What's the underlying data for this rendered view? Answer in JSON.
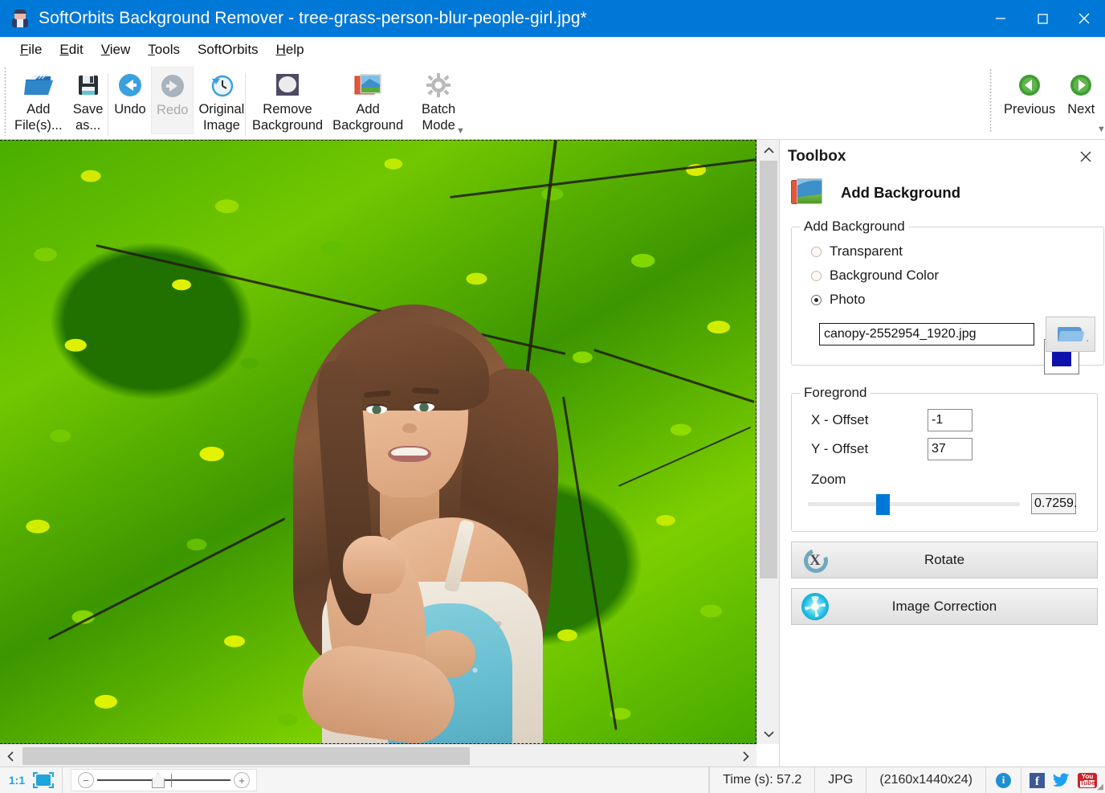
{
  "window": {
    "title": "SoftOrbits Background Remover - tree-grass-person-blur-people-girl.jpg*",
    "app_icon": "person-photo-icon",
    "minimize": "minimize-icon",
    "maximize": "maximize-icon",
    "close": "close-icon",
    "titlebar_color": "#0078d7"
  },
  "menu": {
    "items": [
      {
        "label": "File",
        "accel": "F"
      },
      {
        "label": "Edit",
        "accel": "E"
      },
      {
        "label": "View",
        "accel": "V"
      },
      {
        "label": "Tools",
        "accel": "T"
      },
      {
        "label": "SoftOrbits",
        "accel": ""
      },
      {
        "label": "Help",
        "accel": "H"
      }
    ]
  },
  "toolbar": {
    "buttons": [
      {
        "label": "Add\nFile(s)...",
        "icon": "open-folder-icon",
        "state": "normal"
      },
      {
        "label": "Save\nas...",
        "icon": "floppy-save-icon",
        "state": "normal"
      },
      {
        "label": "Undo",
        "icon": "undo-arrow-icon",
        "state": "normal"
      },
      {
        "label": "Redo",
        "icon": "redo-arrow-icon",
        "state": "disabled"
      },
      {
        "label": "Original\nImage",
        "icon": "clock-history-icon",
        "state": "normal"
      },
      {
        "label": "Remove\nBackground",
        "icon": "remove-background-icon",
        "state": "normal"
      },
      {
        "label": "Add\nBackground",
        "icon": "add-background-icon",
        "state": "normal"
      },
      {
        "label": "Batch\nMode",
        "icon": "gear-icon",
        "state": "normal"
      }
    ],
    "nav": [
      {
        "label": "Previous",
        "icon": "previous-green-arrow-icon"
      },
      {
        "label": "Next",
        "icon": "next-green-arrow-icon"
      }
    ],
    "overflow": "toolbar-overflow-chevron"
  },
  "toolbox": {
    "panel_title": "Toolbox",
    "close_icon": "close-icon",
    "tool_title": "Add Background",
    "tool_icon": "add-background-icon",
    "group_add_background": {
      "legend": "Add Background",
      "options": [
        {
          "label": "Transparent",
          "selected": false
        },
        {
          "label": "Background Color",
          "selected": false
        },
        {
          "label": "Photo",
          "selected": true
        }
      ],
      "background_color_value": "#0f11ac",
      "photo_filename": "canopy-2552954_1920.jpg",
      "browse_icon": "open-folder-icon"
    },
    "group_foreground": {
      "legend": "Foregrond",
      "x_offset_label": "X - Offset",
      "x_offset_value": "-1",
      "y_offset_label": "Y - Offset",
      "y_offset_value": "37",
      "zoom_label": "Zoom",
      "zoom_value": "0.7259.",
      "zoom_slider_percent": 32
    },
    "actions": [
      {
        "label": "Rotate",
        "icon": "rotate-icon"
      },
      {
        "label": "Image Correction",
        "icon": "image-correction-icon"
      }
    ]
  },
  "canvas": {
    "image_description": "Young woman with long brown hair in a light patterned dress with turquoise crochet lace, composited over a green tree canopy background",
    "selection_marquee": "dashed-marquee",
    "vertical_scrollbar": {
      "up_icon": "chevron-up-icon",
      "down_icon": "chevron-down-icon"
    },
    "horizontal_scrollbar": {
      "left_icon": "chevron-left-icon",
      "right_icon": "chevron-right-icon"
    }
  },
  "statusbar": {
    "zoom_ratio": "1:1",
    "fit_icon": "fit-to-window-icon",
    "zoom_out_icon": "minus-icon",
    "zoom_in_icon": "plus-icon",
    "time_label": "Time (s): 57.2",
    "format": "JPG",
    "dimensions": "(2160x1440x24)",
    "icons": [
      {
        "name": "info-icon",
        "glyph": "i"
      },
      {
        "name": "facebook-icon",
        "glyph": "f"
      },
      {
        "name": "twitter-icon",
        "glyph": "twitter-bird"
      },
      {
        "name": "youtube-icon",
        "glyph": "You Tube"
      }
    ]
  }
}
